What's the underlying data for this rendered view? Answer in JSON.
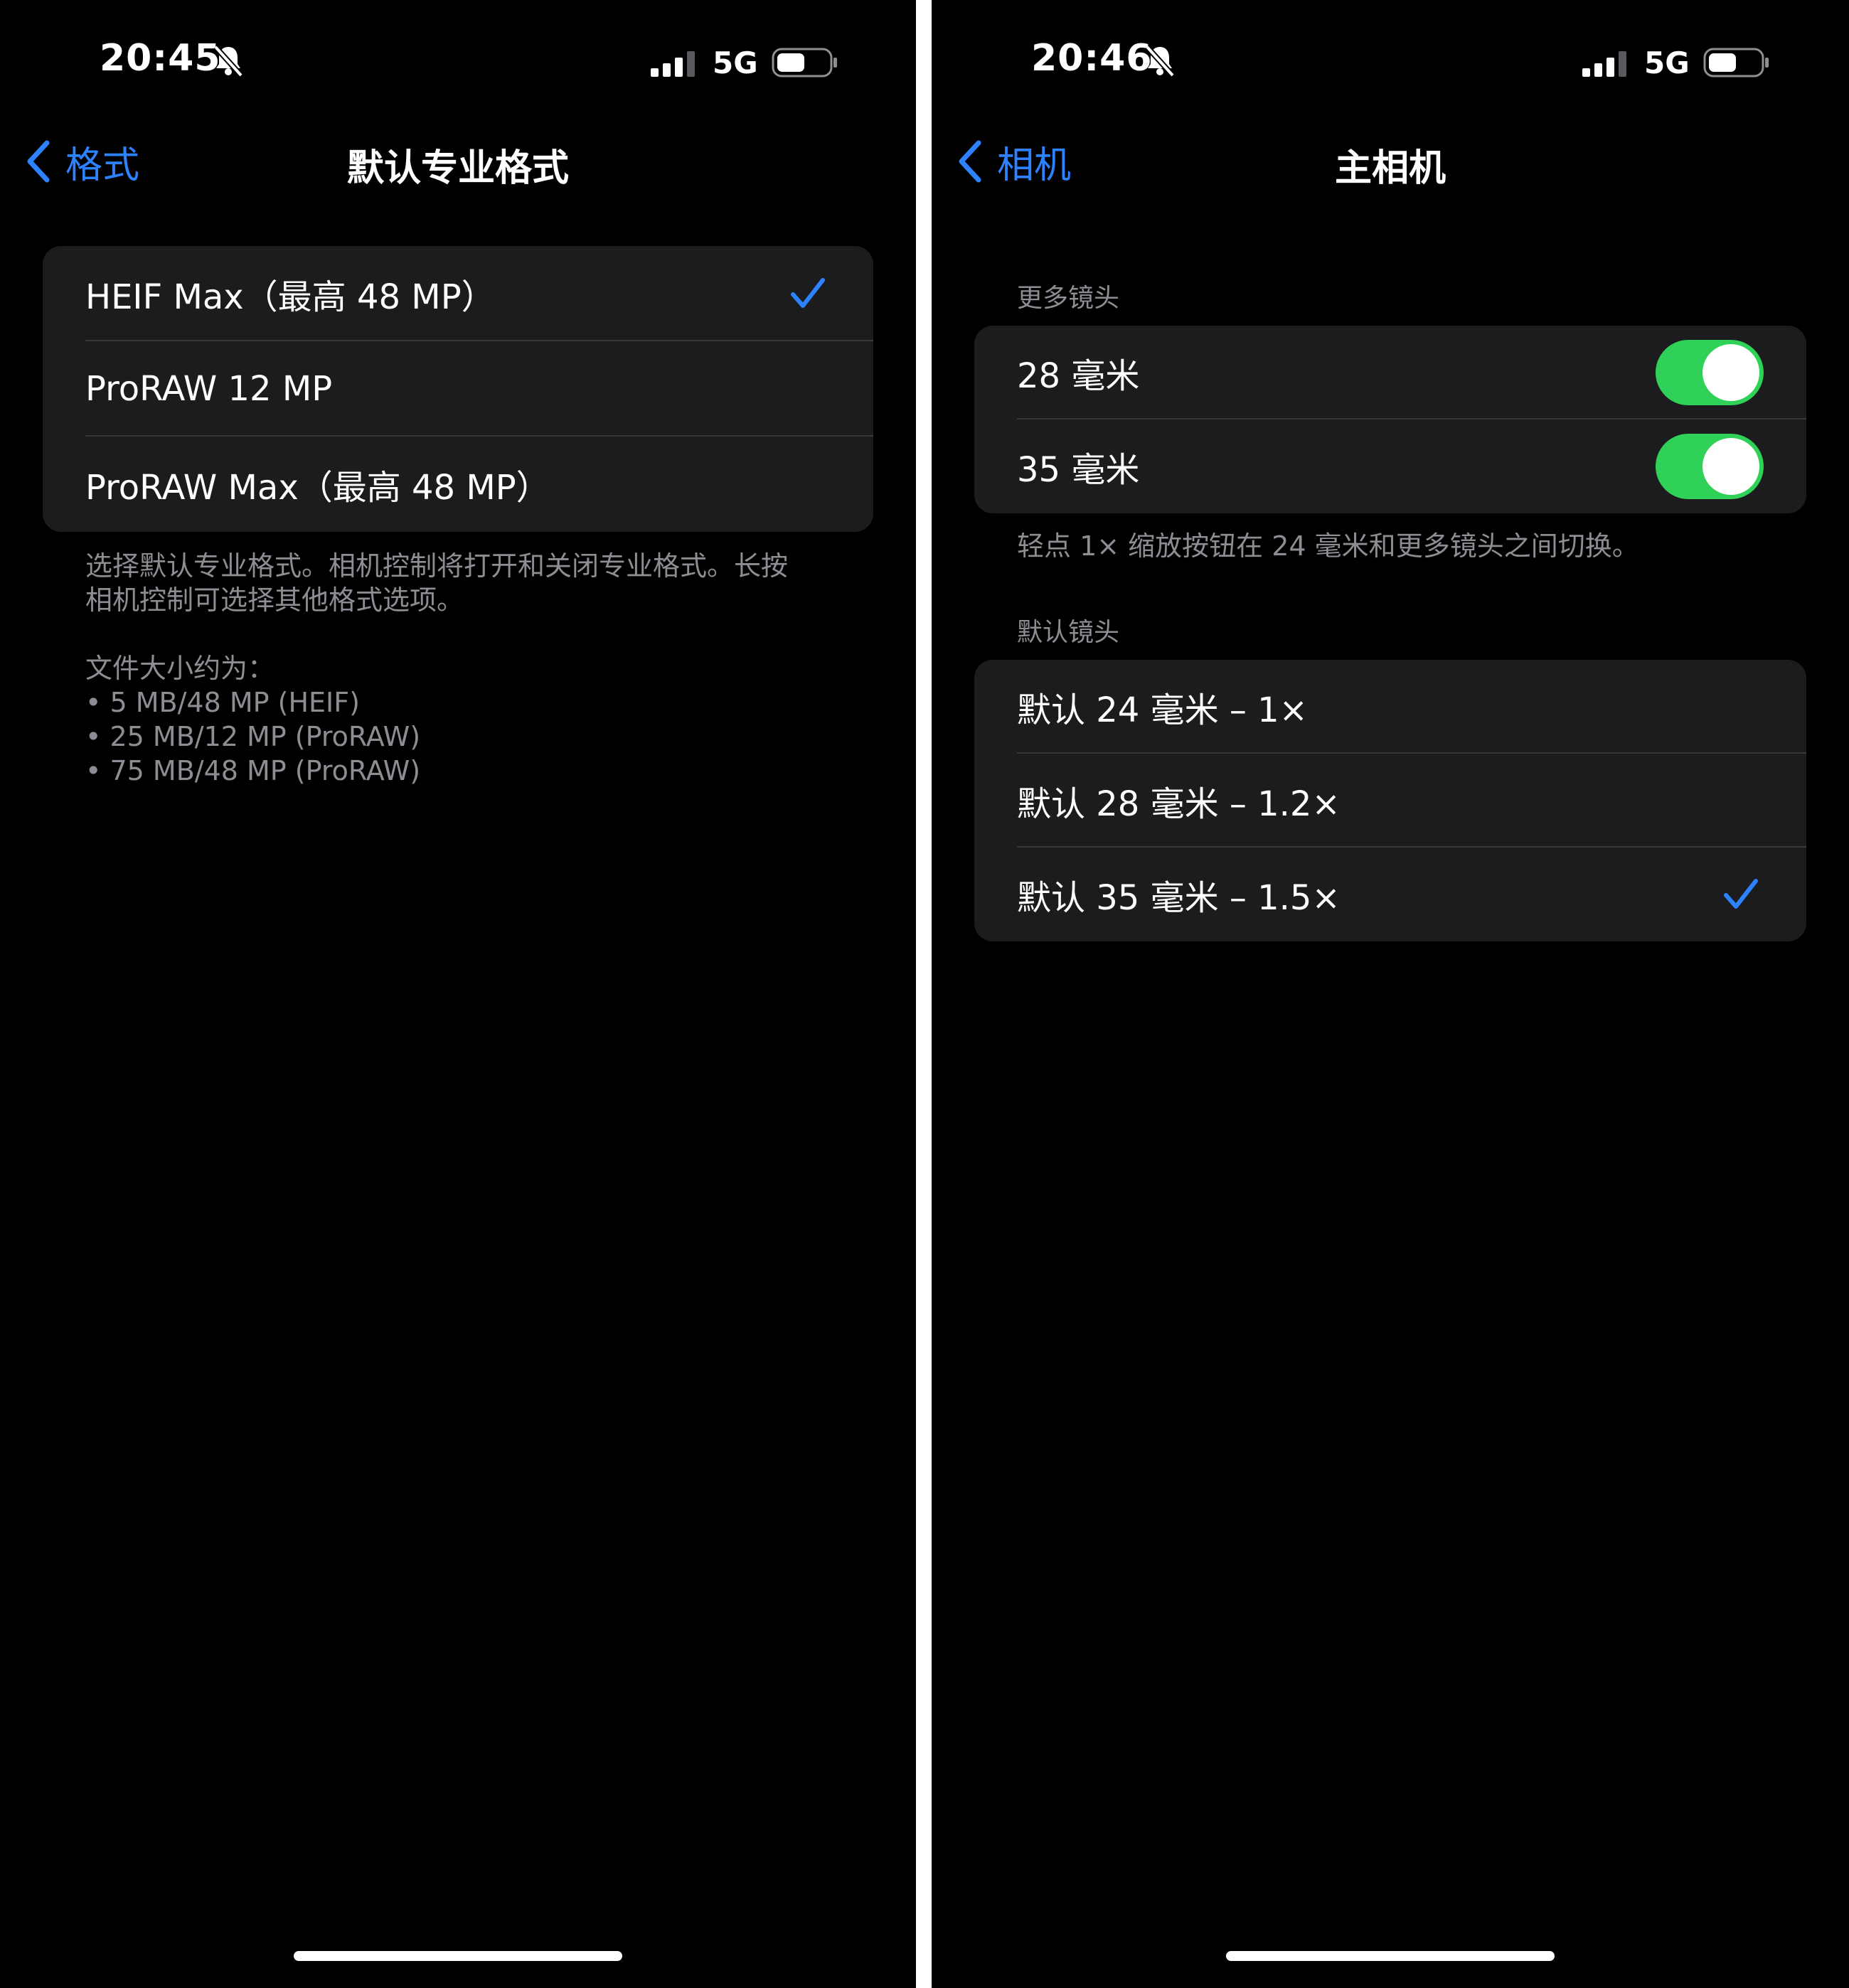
{
  "colors": {
    "background": "#000000",
    "cell": "#1c1c1e",
    "accent": "#2d82ff",
    "toggle_on": "#30d158",
    "secondary_text": "#8d8d93"
  },
  "left": {
    "status": {
      "time": "20:45",
      "network": "5G",
      "icons": [
        "bell-slash-icon",
        "signal-icon",
        "battery-icon"
      ]
    },
    "nav": {
      "back_label": "格式",
      "title": "默认专业格式"
    },
    "options": [
      {
        "label": "HEIF Max（最高 48 MP）",
        "selected": true
      },
      {
        "label": "ProRAW 12 MP",
        "selected": false
      },
      {
        "label": "ProRAW Max（最高 48 MP）",
        "selected": false
      }
    ],
    "footer": {
      "description_line1": "选择默认专业格式。相机控制将打开和关闭专业格式。长按",
      "description_line2": "相机控制可选择其他格式选项。",
      "size_title": "文件大小约为：",
      "sizes": [
        "• 5 MB/48 MP (HEIF)",
        "• 25 MB/12 MP (ProRAW)",
        "• 75 MB/48 MP (ProRAW)"
      ]
    }
  },
  "right": {
    "status": {
      "time": "20:46",
      "network": "5G",
      "icons": [
        "bell-slash-icon",
        "signal-icon",
        "battery-icon"
      ]
    },
    "nav": {
      "back_label": "相机",
      "title": "主相机"
    },
    "more_lenses": {
      "header": "更多镜头",
      "items": [
        {
          "label": "28 毫米",
          "on": true
        },
        {
          "label": "35 毫米",
          "on": true
        }
      ],
      "footer": "轻点 1× 缩放按钮在 24 毫米和更多镜头之间切换。"
    },
    "default_lens": {
      "header": "默认镜头",
      "options": [
        {
          "label": "默认 24 毫米 – 1×",
          "selected": false
        },
        {
          "label": "默认 28 毫米 – 1.2×",
          "selected": false
        },
        {
          "label": "默认 35 毫米 – 1.5×",
          "selected": true
        }
      ]
    }
  }
}
